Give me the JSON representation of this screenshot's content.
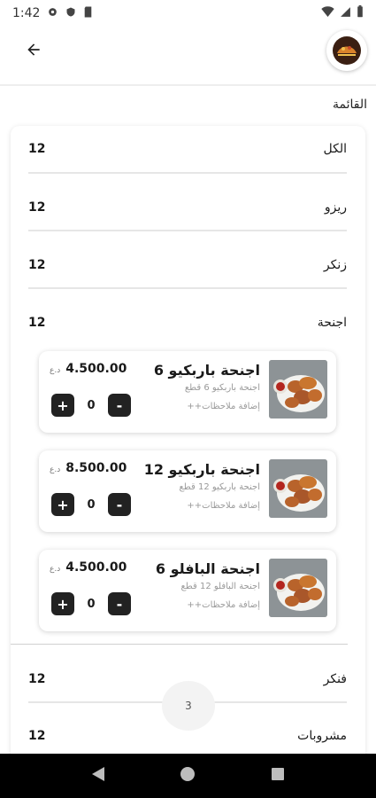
{
  "status_bar": {
    "time": "1:42"
  },
  "header": {
    "section_title": "القائمة"
  },
  "categories": [
    {
      "name": "الكل",
      "count": "12"
    },
    {
      "name": "ريزو",
      "count": "12"
    },
    {
      "name": "زنكر",
      "count": "12"
    },
    {
      "name": "اجنحة",
      "count": "12"
    },
    {
      "name": "فنكر",
      "count": "12"
    },
    {
      "name": "مشروبات",
      "count": "12"
    }
  ],
  "items": [
    {
      "name": "اجنحة باربكيو 6",
      "desc": "اجنحة باربكيو 6 قطع",
      "notes": "إضافة ملاحظات++",
      "price": "4.500.00",
      "currency": "د.ع",
      "quantity": "0"
    },
    {
      "name": "اجنحة باربكيو 12",
      "desc": "اجنحة باربكيو 12 قطع",
      "notes": "إضافة ملاحظات++",
      "price": "8.500.00",
      "currency": "د.ع",
      "quantity": "0"
    },
    {
      "name": "اجنحة البافلو 6",
      "desc": "اجنحة البافلو 12 قطع",
      "notes": "إضافة ملاحظات++",
      "price": "4.500.00",
      "currency": "د.ع",
      "quantity": "0"
    }
  ],
  "controls": {
    "plus": "+",
    "minus": "-"
  },
  "page_indicator": "3",
  "icons": {
    "back": "arrow-left-icon",
    "logo": "restaurant-logo",
    "nav_back": "triangle-back-icon",
    "nav_home": "circle-home-icon",
    "nav_recent": "square-recent-icon"
  },
  "colors": {
    "button": "#222222",
    "nav_bar": "#000000",
    "divider": "#e6e6e6"
  }
}
